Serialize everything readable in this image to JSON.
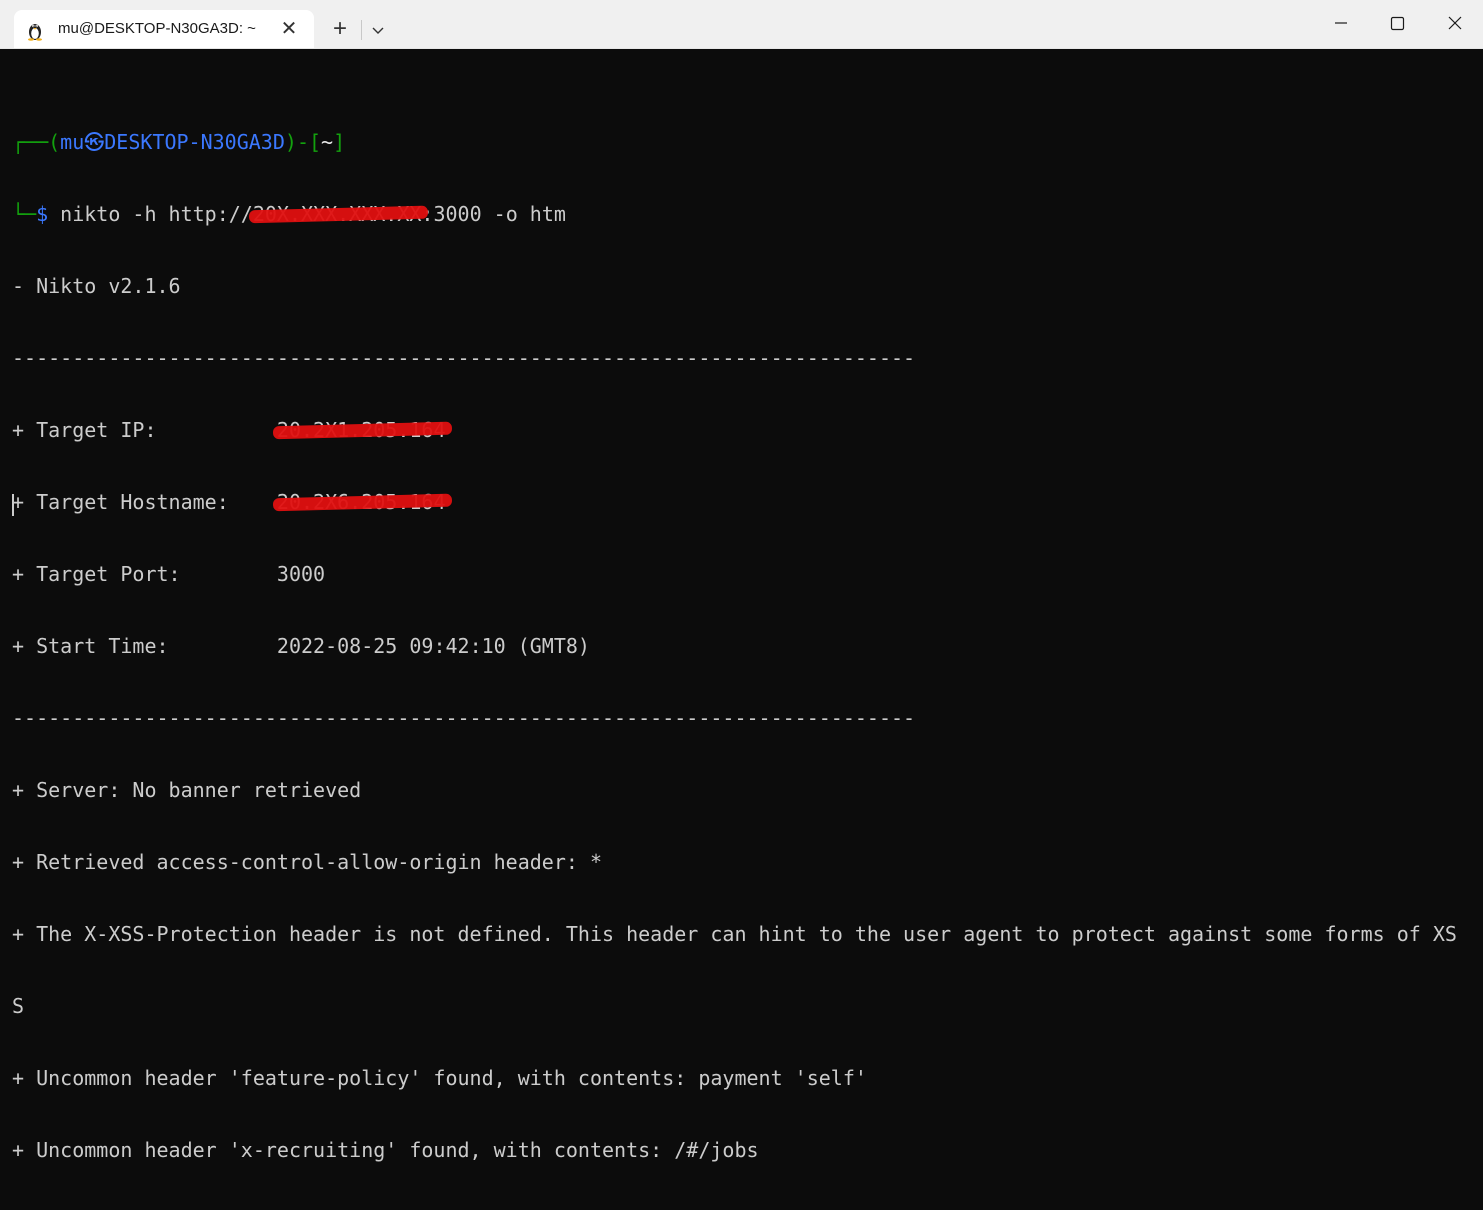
{
  "window": {
    "tab_title": "mu@DESKTOP-N30GA3D: ~",
    "tab_icon": "linux-penguin-icon",
    "new_tab_label": "+",
    "close_tab_label": "✕"
  },
  "terminal": {
    "prompt": {
      "corner_top": "┌──",
      "open_paren": "(",
      "user": "mu",
      "at_symbol": "㉿",
      "host": "DESKTOP-N30GA3D",
      "close_paren": ")",
      "dash": "-",
      "dir_open": "[",
      "dir": "~",
      "dir_close": "]",
      "corner_bottom": "└─",
      "dollar": "$",
      "cmd_before": " nikto -h http://",
      "cmd_redacted": "20X.XXX.XXX.XX",
      "cmd_after": ":3000 -o htm"
    },
    "version_line": "- Nikto v2.1.6",
    "separator": "---------------------------------------------------------------------------",
    "target_ip_label": "+ Target IP:          ",
    "target_ip_value": "20.2X1.205.164",
    "target_hostname_label": "+ Target Hostname:    ",
    "target_hostname_value": "20.2X6.205.164",
    "target_port_label": "+ Target Port:        ",
    "target_port_value": "3000",
    "start_time_label": "+ Start Time:         ",
    "start_time_value": "2022-08-25 09:42:10 (GMT8)",
    "output_lines": [
      "+ Server: No banner retrieved",
      "+ Retrieved access-control-allow-origin header: *",
      "+ The X-XSS-Protection header is not defined. This header can hint to the user agent to protect against some forms of XS",
      "S",
      "+ Uncommon header 'feature-policy' found, with contents: payment 'self'",
      "+ Uncommon header 'x-recruiting' found, with contents: /#/jobs"
    ]
  },
  "colors": {
    "background": "#0c0c0c",
    "text": "#cccccc",
    "prompt_green": "#13a10e",
    "prompt_blue": "#3b78ff",
    "redaction": "#e01010"
  }
}
